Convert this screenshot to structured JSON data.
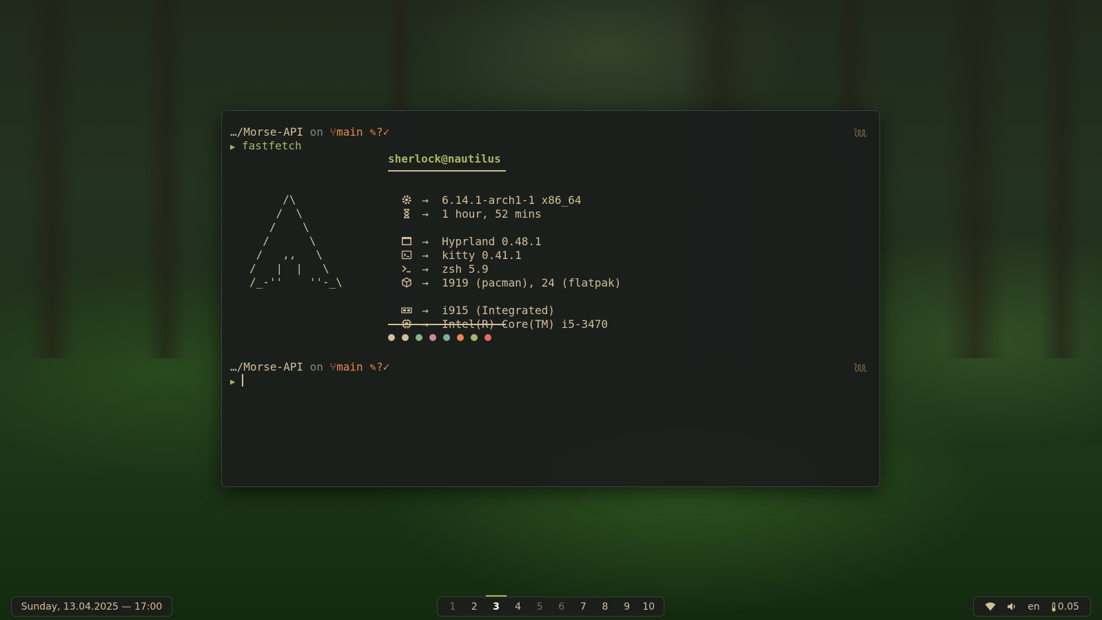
{
  "terminal": {
    "prompt1": {
      "dir": "…/Morse-API",
      "on": "on",
      "branch": "main",
      "status": "?✓",
      "command": "fastfetch"
    },
    "fetch": {
      "host": "sherlock@nautilus",
      "logo": "     /\\\n    /  \\\n   /    \\\n  /      \\\n /   ,,   \\\n/   |  |   \\\n/_-''    ''-_\\",
      "rows": [
        {
          "icon": "gear-icon",
          "value": "6.14.1-arch1-1 x86_64"
        },
        {
          "icon": "hourglass-icon",
          "value": "1 hour, 52 mins"
        },
        {
          "icon": "window-icon",
          "value": "Hyprland 0.48.1"
        },
        {
          "icon": "terminal-icon",
          "value": "kitty 0.41.1"
        },
        {
          "icon": "shell-icon",
          "value": "zsh 5.9"
        },
        {
          "icon": "package-icon",
          "value": "1919 (pacman), 24 (flatpak)"
        },
        {
          "icon": "gpu-icon",
          "value": "i915 (Integrated)"
        },
        {
          "icon": "cpu-icon",
          "value": "Intel(R) Core(TM) i5-3470"
        }
      ],
      "arrow": "→",
      "palette": [
        "#d4be98",
        "#d4be98",
        "#89b482",
        "#d3869b",
        "#7daea3",
        "#e78a4e",
        "#a9b665",
        "#ea6962"
      ]
    },
    "prompt2": {
      "dir": "…/Morse-API",
      "on": "on",
      "branch": "main",
      "status": "?✓"
    }
  },
  "bar": {
    "datetime": "Sunday, 13.04.2025 — 17:00",
    "workspaces": [
      "1",
      "2",
      "3",
      "4",
      "5",
      "6",
      "7",
      "8",
      "9",
      "10"
    ],
    "active_workspace": "3",
    "language": "en",
    "temperature": "0.05"
  }
}
